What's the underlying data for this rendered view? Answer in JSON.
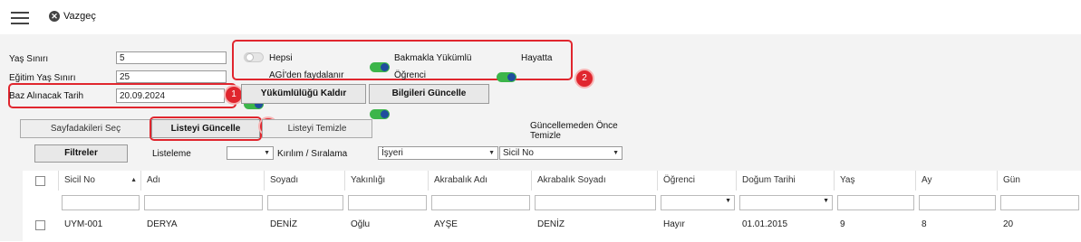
{
  "toolbar": {
    "cancel_label": "Vazgeç",
    "cancel_icon": "close-icon",
    "menu_icon": "hamburger-icon"
  },
  "form": {
    "yas_siniri_label": "Yaş Sınırı",
    "yas_siniri_value": "5",
    "egitim_yas_label": "Eğitim Yaş Sınırı",
    "egitim_yas_value": "25",
    "baz_tarih_label": "Baz Alınacak Tarih",
    "baz_tarih_value": "20.09.2024"
  },
  "toggles": {
    "hepsi": {
      "label": "Hepsi",
      "on": false
    },
    "bakmakla": {
      "label": "Bakmakla Yükümlü",
      "on": true
    },
    "hayatta": {
      "label": "Hayatta",
      "on": true
    },
    "agi": {
      "label": "AGİ'den faydalanır",
      "on": true
    },
    "ogrenci": {
      "label": "Öğrenci",
      "on": true
    },
    "guncelle_oncesi": {
      "label_line1": "Güncellemeden Önce",
      "label_line2": "Temizle",
      "on": true
    }
  },
  "buttons": {
    "yukumluluk_kaldir": "Yükümlülüğü Kaldır",
    "bilgileri_guncelle": "Bilgileri Güncelle",
    "sayfadakileri_sec": "Sayfadakileri Seç",
    "listeyi_guncelle": "Listeyi Güncelle",
    "listeyi_temizle": "Listeyi Temizle",
    "filtreler": "Filtreler"
  },
  "filters": {
    "listeleme_label": "Listeleme",
    "listeleme_value": "",
    "kirilim_label": "Kırılım / Sıralama",
    "kirilim_value": "İşyeri",
    "sicil_value": "Sicil No"
  },
  "badges": [
    "1",
    "2",
    "3"
  ],
  "table": {
    "columns": [
      "Sicil No",
      "Adı",
      "Soyadı",
      "Yakınlığı",
      "Akrabalık Adı",
      "Akrabalık Soyadı",
      "Öğrenci",
      "Doğum Tarihi",
      "Yaş",
      "Ay",
      "Gün"
    ],
    "sort_indicator": "▲",
    "rows": [
      [
        "UYM-001",
        "DERYA",
        "DENİZ",
        "Oğlu",
        "AYŞE",
        "DENİZ",
        "Hayır",
        "01.01.2015",
        "9",
        "8",
        "20"
      ]
    ]
  },
  "colors": {
    "accent_red": "#e0262e",
    "toggle_on": "#3cb54a",
    "knob": "#1f4d9e"
  }
}
